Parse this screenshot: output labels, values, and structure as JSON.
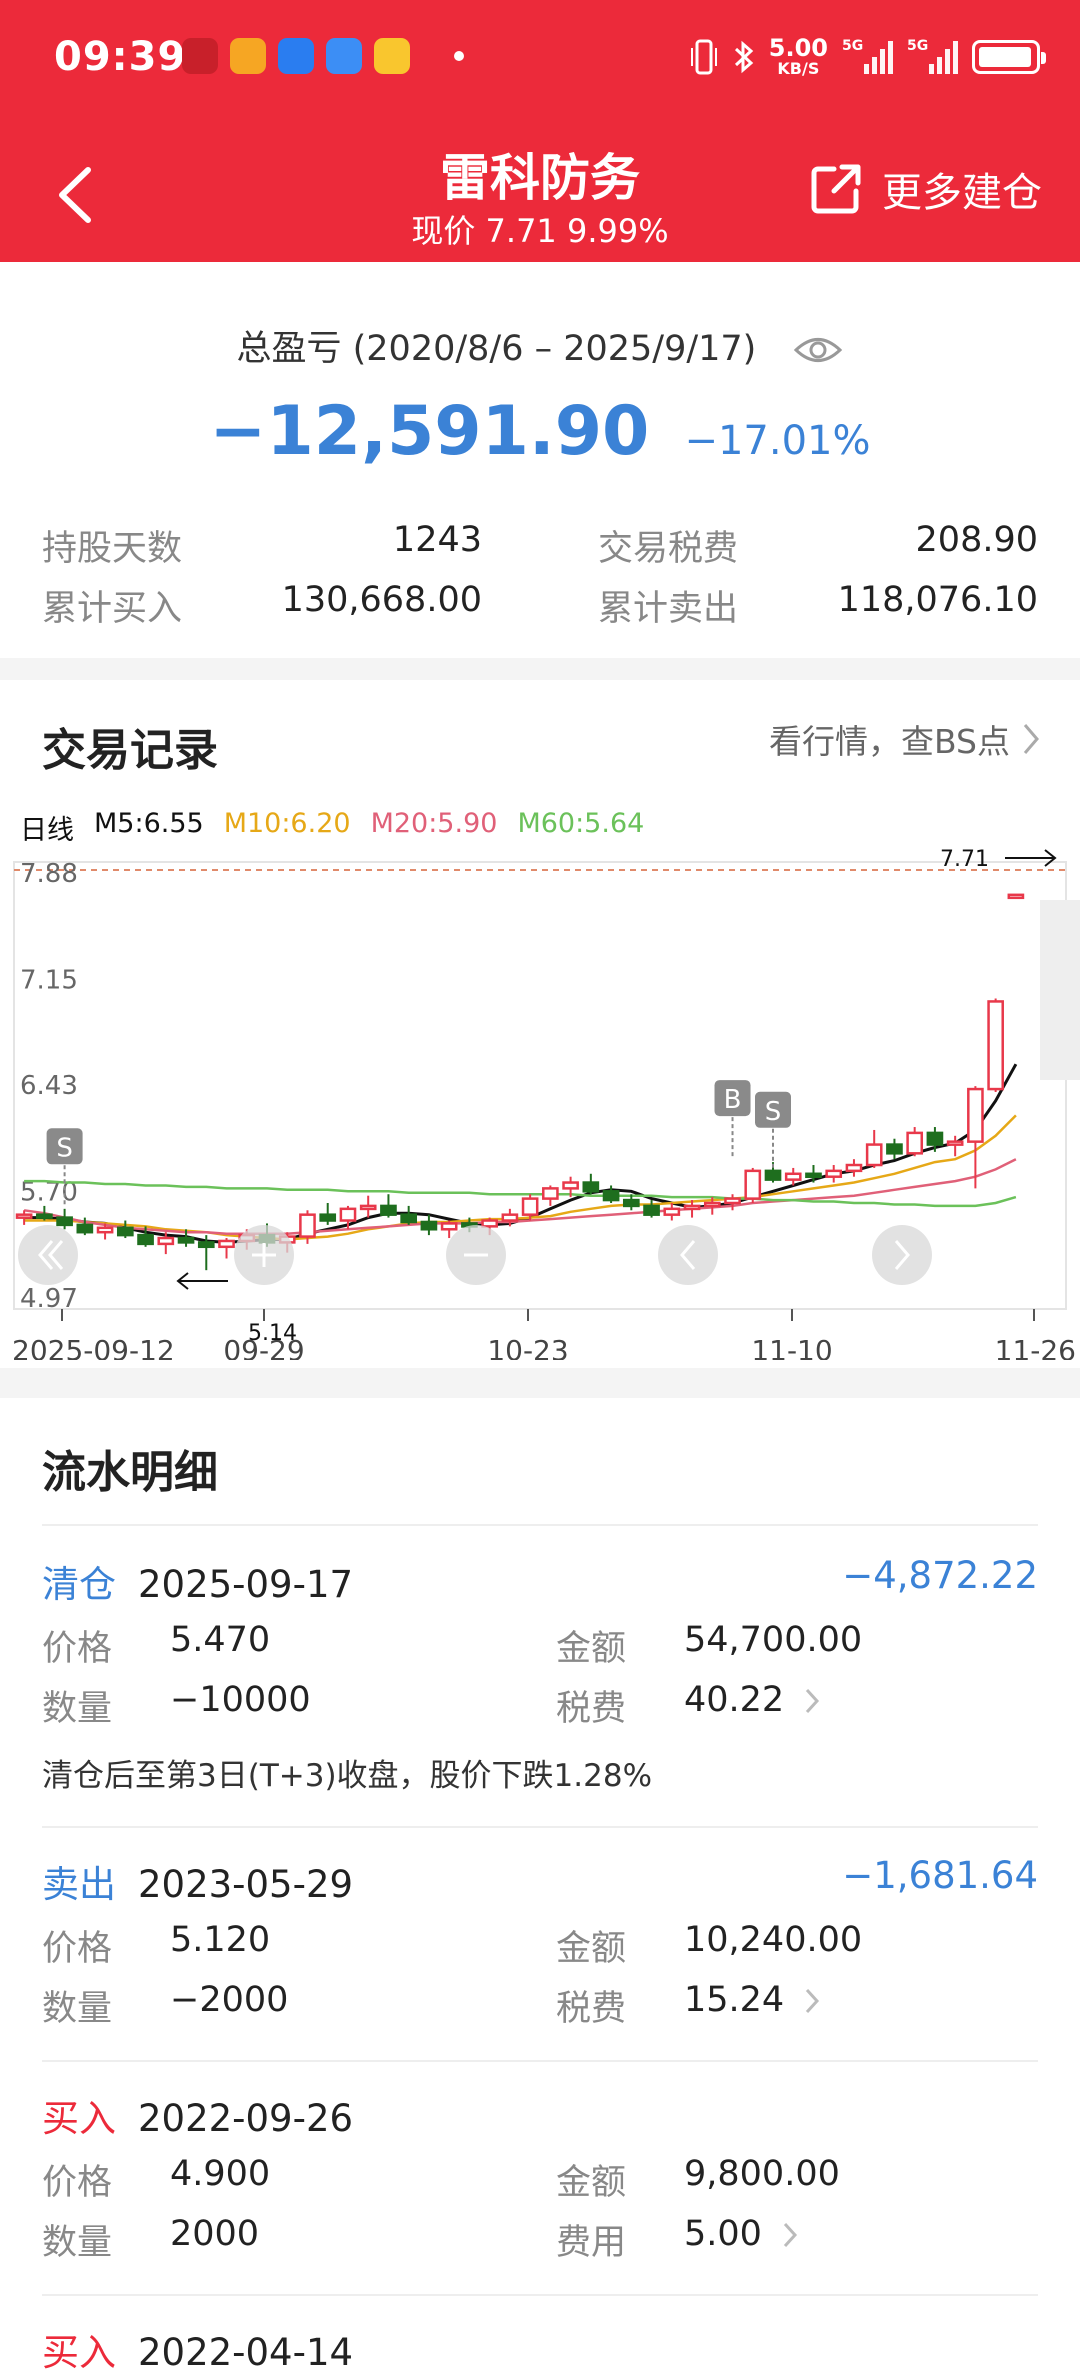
{
  "status": {
    "time": "09:39",
    "speed_value": "5.00",
    "speed_unit": "KB/S",
    "net1": "5G",
    "net2": "5G"
  },
  "header": {
    "title": "雷科防务",
    "subtitle": "现价 7.71 9.99%",
    "more_label": "更多建仓"
  },
  "summary": {
    "label": "总盈亏 (2020/8/6 – 2025/9/17)",
    "total": "−12,591.90",
    "pct": "−17.01%",
    "stats": [
      {
        "key": "持股天数",
        "value": "1243"
      },
      {
        "key": "交易税费",
        "value": "208.90"
      },
      {
        "key": "累计买入",
        "value": "130,668.00"
      },
      {
        "key": "累计卖出",
        "value": "118,076.10"
      }
    ]
  },
  "trades": {
    "title": "交易记录",
    "link": "看行情，查BS点",
    "legend": {
      "period": "日线",
      "m5": "M5:6.55",
      "m10": "M10:6.20",
      "m20": "M20:5.90",
      "m60": "M60:5.64"
    }
  },
  "colors": {
    "up": "#e8384a",
    "down": "#1e6e1e",
    "accent": "#3b82d6",
    "brand": "#ec2a3a"
  },
  "chart_data": {
    "type": "candlestick",
    "y_ticks": [
      "7.88",
      "7.15",
      "6.43",
      "5.70",
      "4.97"
    ],
    "ylim": [
      4.97,
      7.88
    ],
    "x_ticks": [
      "2025-09-12",
      "09-29",
      "10-23",
      "11-10",
      "11-26"
    ],
    "last_price_label": "7.71",
    "min_price_label": "5.14",
    "candles": [
      [
        5.5,
        5.55,
        5.45,
        5.52
      ],
      [
        5.52,
        5.58,
        5.48,
        5.5
      ],
      [
        5.5,
        5.56,
        5.42,
        5.45
      ],
      [
        5.45,
        5.5,
        5.38,
        5.4
      ],
      [
        5.4,
        5.46,
        5.35,
        5.43
      ],
      [
        5.43,
        5.48,
        5.36,
        5.38
      ],
      [
        5.38,
        5.44,
        5.3,
        5.32
      ],
      [
        5.32,
        5.4,
        5.25,
        5.36
      ],
      [
        5.36,
        5.42,
        5.3,
        5.33
      ],
      [
        5.33,
        5.38,
        5.14,
        5.3
      ],
      [
        5.3,
        5.36,
        5.22,
        5.34
      ],
      [
        5.34,
        5.42,
        5.28,
        5.38
      ],
      [
        5.38,
        5.46,
        5.3,
        5.33
      ],
      [
        5.33,
        5.4,
        5.26,
        5.37
      ],
      [
        5.37,
        5.55,
        5.32,
        5.52
      ],
      [
        5.52,
        5.6,
        5.45,
        5.48
      ],
      [
        5.48,
        5.58,
        5.42,
        5.56
      ],
      [
        5.56,
        5.65,
        5.5,
        5.58
      ],
      [
        5.58,
        5.66,
        5.5,
        5.52
      ],
      [
        5.52,
        5.58,
        5.45,
        5.47
      ],
      [
        5.47,
        5.52,
        5.38,
        5.42
      ],
      [
        5.42,
        5.48,
        5.36,
        5.46
      ],
      [
        5.46,
        5.5,
        5.4,
        5.44
      ],
      [
        5.44,
        5.5,
        5.38,
        5.48
      ],
      [
        5.48,
        5.56,
        5.44,
        5.52
      ],
      [
        5.52,
        5.66,
        5.48,
        5.63
      ],
      [
        5.63,
        5.72,
        5.58,
        5.7
      ],
      [
        5.7,
        5.78,
        5.64,
        5.74
      ],
      [
        5.74,
        5.8,
        5.66,
        5.68
      ],
      [
        5.68,
        5.72,
        5.6,
        5.62
      ],
      [
        5.62,
        5.66,
        5.55,
        5.58
      ],
      [
        5.58,
        5.62,
        5.5,
        5.52
      ],
      [
        5.52,
        5.6,
        5.48,
        5.56
      ],
      [
        5.56,
        5.62,
        5.5,
        5.58
      ],
      [
        5.58,
        5.64,
        5.52,
        5.6
      ],
      [
        5.6,
        5.66,
        5.55,
        5.63
      ],
      [
        5.63,
        5.84,
        5.6,
        5.82
      ],
      [
        5.82,
        5.88,
        5.74,
        5.76
      ],
      [
        5.76,
        5.84,
        5.72,
        5.8
      ],
      [
        5.8,
        5.86,
        5.74,
        5.78
      ],
      [
        5.78,
        5.86,
        5.74,
        5.82
      ],
      [
        5.82,
        5.9,
        5.78,
        5.86
      ],
      [
        5.86,
        6.1,
        5.84,
        6.0
      ],
      [
        6.0,
        6.04,
        5.9,
        5.94
      ],
      [
        5.94,
        6.12,
        5.92,
        6.08
      ],
      [
        6.08,
        6.12,
        5.95,
        6.0
      ],
      [
        6.0,
        6.06,
        5.92,
        6.02
      ],
      [
        6.02,
        6.4,
        5.7,
        6.38
      ],
      [
        6.38,
        7.0,
        6.36,
        6.98
      ],
      [
        7.71,
        7.71,
        7.71,
        7.71
      ]
    ],
    "markers": [
      {
        "label": "S",
        "index": 2,
        "price": 5.55
      },
      {
        "label": "B",
        "index": 35,
        "price": 5.88
      },
      {
        "label": "S",
        "index": 37,
        "price": 5.8
      }
    ],
    "series": [
      {
        "name": "M5",
        "color": "#111111",
        "values": [
          5.5,
          5.5,
          5.49,
          5.47,
          5.46,
          5.43,
          5.4,
          5.38,
          5.37,
          5.34,
          5.33,
          5.34,
          5.35,
          5.35,
          5.39,
          5.42,
          5.45,
          5.5,
          5.53,
          5.53,
          5.52,
          5.49,
          5.46,
          5.45,
          5.46,
          5.5,
          5.56,
          5.62,
          5.67,
          5.69,
          5.68,
          5.63,
          5.6,
          5.57,
          5.58,
          5.6,
          5.64,
          5.68,
          5.72,
          5.76,
          5.8,
          5.82,
          5.86,
          5.89,
          5.94,
          5.98,
          6.01,
          6.1,
          6.3,
          6.55
        ]
      },
      {
        "name": "M10",
        "color": "#e6a817",
        "values": [
          5.48,
          5.48,
          5.48,
          5.47,
          5.46,
          5.45,
          5.44,
          5.42,
          5.41,
          5.4,
          5.38,
          5.37,
          5.36,
          5.35,
          5.36,
          5.37,
          5.39,
          5.42,
          5.44,
          5.46,
          5.47,
          5.47,
          5.48,
          5.49,
          5.49,
          5.5,
          5.51,
          5.54,
          5.56,
          5.58,
          5.59,
          5.59,
          5.6,
          5.61,
          5.62,
          5.63,
          5.64,
          5.66,
          5.68,
          5.7,
          5.72,
          5.74,
          5.77,
          5.8,
          5.84,
          5.88,
          5.9,
          5.96,
          6.06,
          6.2
        ]
      },
      {
        "name": "M20",
        "color": "#e06078",
        "values": [
          5.55,
          5.53,
          5.5,
          5.47,
          5.45,
          5.43,
          5.42,
          5.41,
          5.4,
          5.4,
          5.39,
          5.39,
          5.39,
          5.39,
          5.4,
          5.41,
          5.42,
          5.43,
          5.44,
          5.45,
          5.46,
          5.46,
          5.46,
          5.47,
          5.47,
          5.48,
          5.49,
          5.5,
          5.51,
          5.52,
          5.53,
          5.54,
          5.55,
          5.56,
          5.57,
          5.58,
          5.6,
          5.61,
          5.62,
          5.63,
          5.64,
          5.65,
          5.67,
          5.69,
          5.71,
          5.73,
          5.75,
          5.78,
          5.83,
          5.9
        ]
      },
      {
        "name": "M60",
        "color": "#6bc15a",
        "values": [
          5.75,
          5.75,
          5.74,
          5.74,
          5.73,
          5.73,
          5.72,
          5.72,
          5.71,
          5.71,
          5.7,
          5.7,
          5.7,
          5.69,
          5.69,
          5.69,
          5.68,
          5.68,
          5.68,
          5.67,
          5.67,
          5.67,
          5.67,
          5.66,
          5.66,
          5.66,
          5.66,
          5.66,
          5.65,
          5.65,
          5.65,
          5.65,
          5.64,
          5.64,
          5.64,
          5.63,
          5.63,
          5.62,
          5.62,
          5.61,
          5.61,
          5.6,
          5.6,
          5.59,
          5.59,
          5.58,
          5.58,
          5.58,
          5.6,
          5.64
        ]
      }
    ]
  },
  "details": {
    "title": "流水明细",
    "labels": {
      "price": "价格",
      "qty": "数量",
      "amount": "金额",
      "tax": "税费",
      "fee": "费用"
    },
    "records": [
      {
        "type": "清仓",
        "kind": "sell",
        "date": "2025-09-17",
        "pl": "−4,872.22",
        "price": "5.470",
        "qty": "−10000",
        "amount": "54,700.00",
        "tax": "40.22",
        "note": "清仓后至第3日(T+3)收盘，股价下跌1.28%"
      },
      {
        "type": "卖出",
        "kind": "sell",
        "date": "2023-05-29",
        "pl": "−1,681.64",
        "price": "5.120",
        "qty": "−2000",
        "amount": "10,240.00",
        "tax": "15.24"
      },
      {
        "type": "买入",
        "kind": "buy",
        "date": "2022-09-26",
        "price": "4.900",
        "qty": "2000",
        "amount": "9,800.00",
        "tax": "5.00"
      },
      {
        "type": "买入",
        "kind": "buy",
        "date": "2022-04-14"
      }
    ]
  }
}
